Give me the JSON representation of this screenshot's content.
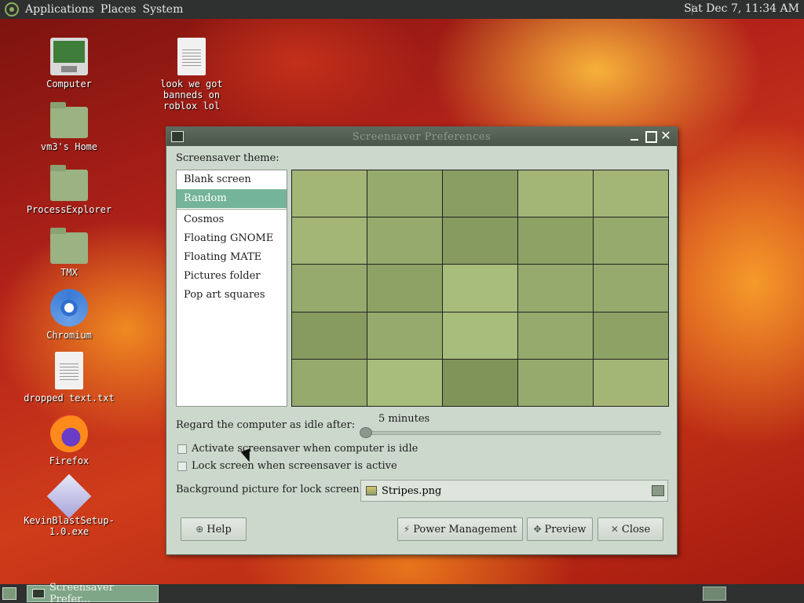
{
  "top_panel": {
    "menus": [
      "Applications",
      "Places",
      "System"
    ],
    "clock": "Sat Dec  7, 11:34 AM"
  },
  "desktop": {
    "icons": [
      {
        "label": "Computer",
        "icon": "computer-icon"
      },
      {
        "label": "vm3's Home",
        "icon": "home-folder-icon"
      },
      {
        "label": "ProcessExplorer",
        "icon": "folder-icon"
      },
      {
        "label": "TMX",
        "icon": "folder-icon"
      },
      {
        "label": "Chromium",
        "icon": "chromium-icon"
      },
      {
        "label": "dropped text.txt",
        "icon": "text-file-icon"
      },
      {
        "label": "Firefox",
        "icon": "firefox-icon"
      },
      {
        "label": "KevinBlastSetup-1.0.exe",
        "icon": "installer-icon"
      },
      {
        "label": "look we got banneds on roblox lol",
        "icon": "text-file-icon"
      }
    ]
  },
  "dialog": {
    "title": "Screensaver Preferences",
    "theme_label": "Screensaver theme:",
    "themes": [
      "Blank screen",
      "Random",
      "Cosmos",
      "Floating GNOME",
      "Floating MATE",
      "Pictures folder",
      "Pop art squares"
    ],
    "selected_theme": "Random",
    "preview_colors": [
      [
        "#a3b676",
        "#95aa6c",
        "#8a9d62",
        "#a3b676",
        "#a3b676"
      ],
      [
        "#a3b676",
        "#95aa6c",
        "#879a60",
        "#8ea265",
        "#95aa6c"
      ],
      [
        "#95aa6c",
        "#8ea265",
        "#a8bc7c",
        "#95aa6c",
        "#95aa6c"
      ],
      [
        "#879a60",
        "#95aa6c",
        "#a8bc7c",
        "#95aa6c",
        "#8ea265"
      ],
      [
        "#95aa6c",
        "#a8bc7c",
        "#809459",
        "#95aa6c",
        "#a3b676"
      ]
    ],
    "idle_label": "Regard the computer as idle after:",
    "idle_value": "5 minutes",
    "idle_fraction": 0.0,
    "activate_label": "Activate screensaver when computer is idle",
    "activate_checked": false,
    "lock_label": "Lock screen when screensaver is active",
    "lock_checked": false,
    "lock_bg_label": "Background picture for lock screen:",
    "lock_bg_file": "Stripes.png",
    "buttons": {
      "help": "Help",
      "power": "Power Management",
      "preview": "Preview",
      "close": "Close"
    }
  },
  "taskbar": {
    "window_button": "Screensaver Prefer..."
  }
}
